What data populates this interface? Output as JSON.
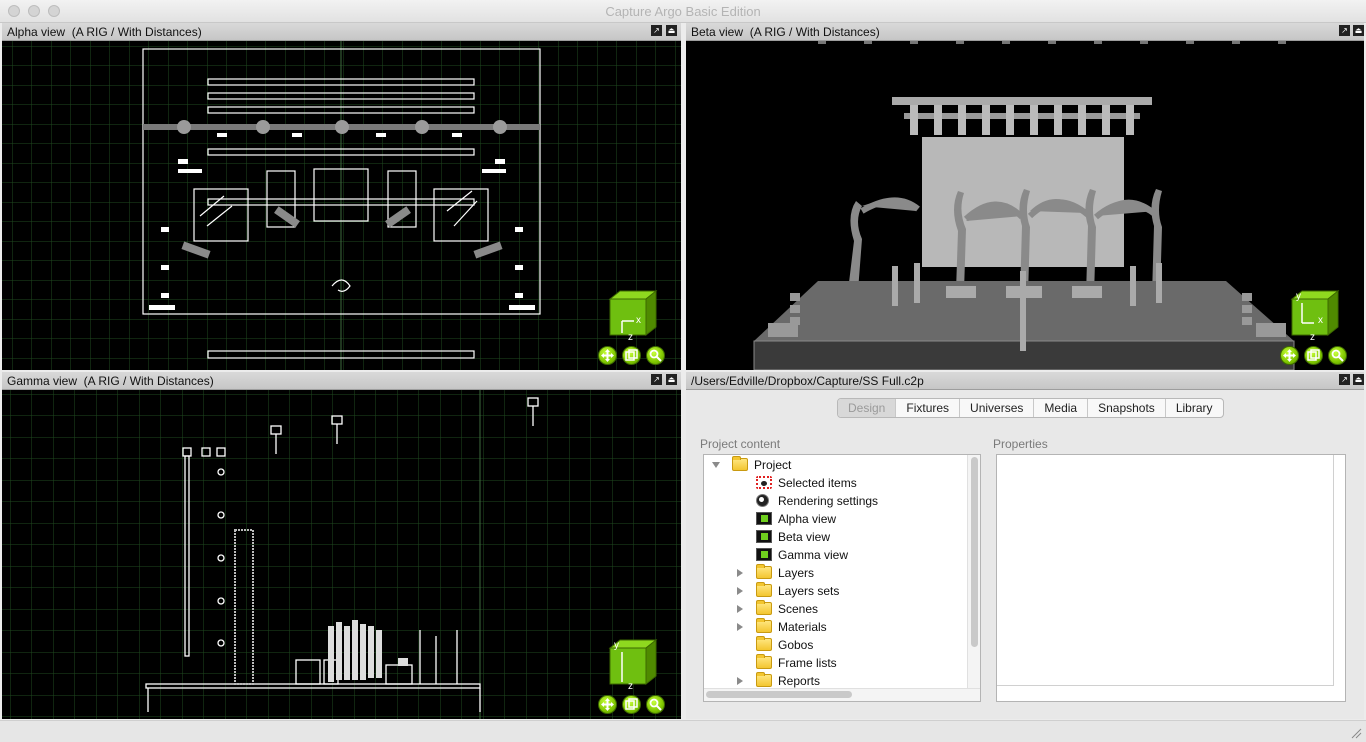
{
  "window": {
    "title": "Capture Argo Basic Edition"
  },
  "alpha": {
    "title": "Alpha view  (A RIG / With Distances)",
    "axis_labels": [
      "x",
      "z"
    ]
  },
  "beta": {
    "title": "Beta view  (A RIG / With Distances)",
    "axis_labels": [
      "y",
      "x",
      "z"
    ]
  },
  "gamma": {
    "title": "Gamma view  (A RIG / With Distances)",
    "axis_labels": [
      "y",
      "z"
    ]
  },
  "project": {
    "path": "/Users/Edville/Dropbox/Capture/SS Full.c2p",
    "tabs": [
      "Design",
      "Fixtures",
      "Universes",
      "Media",
      "Snapshots",
      "Library"
    ],
    "active_tab": "Design",
    "content_label": "Project content",
    "properties_label": "Properties",
    "tree": [
      {
        "label": "Project",
        "level": 0,
        "icon": "folder-icon",
        "expander": "expanded"
      },
      {
        "label": "Selected items",
        "level": 1,
        "icon": "selection-icon",
        "expander": "none"
      },
      {
        "label": "Rendering settings",
        "level": 1,
        "icon": "render-icon",
        "expander": "none"
      },
      {
        "label": "Alpha view",
        "level": 1,
        "icon": "view-icon",
        "expander": "none"
      },
      {
        "label": "Beta view",
        "level": 1,
        "icon": "view-icon",
        "expander": "none"
      },
      {
        "label": "Gamma view",
        "level": 1,
        "icon": "view-icon",
        "expander": "none"
      },
      {
        "label": "Layers",
        "level": 1,
        "icon": "folder-icon",
        "expander": "collapsed"
      },
      {
        "label": "Layers sets",
        "level": 1,
        "icon": "folder-icon",
        "expander": "collapsed"
      },
      {
        "label": "Scenes",
        "level": 1,
        "icon": "folder-icon",
        "expander": "collapsed"
      },
      {
        "label": "Materials",
        "level": 1,
        "icon": "folder-icon",
        "expander": "collapsed"
      },
      {
        "label": "Gobos",
        "level": 1,
        "icon": "folder-icon",
        "expander": "none"
      },
      {
        "label": "Frame lists",
        "level": 1,
        "icon": "folder-icon",
        "expander": "none"
      },
      {
        "label": "Reports",
        "level": 1,
        "icon": "folder-icon",
        "expander": "collapsed"
      }
    ]
  },
  "colors": {
    "grid": "#1f4a1f",
    "tool_green": "#7fc600",
    "cube_green": "#6fbf10"
  }
}
